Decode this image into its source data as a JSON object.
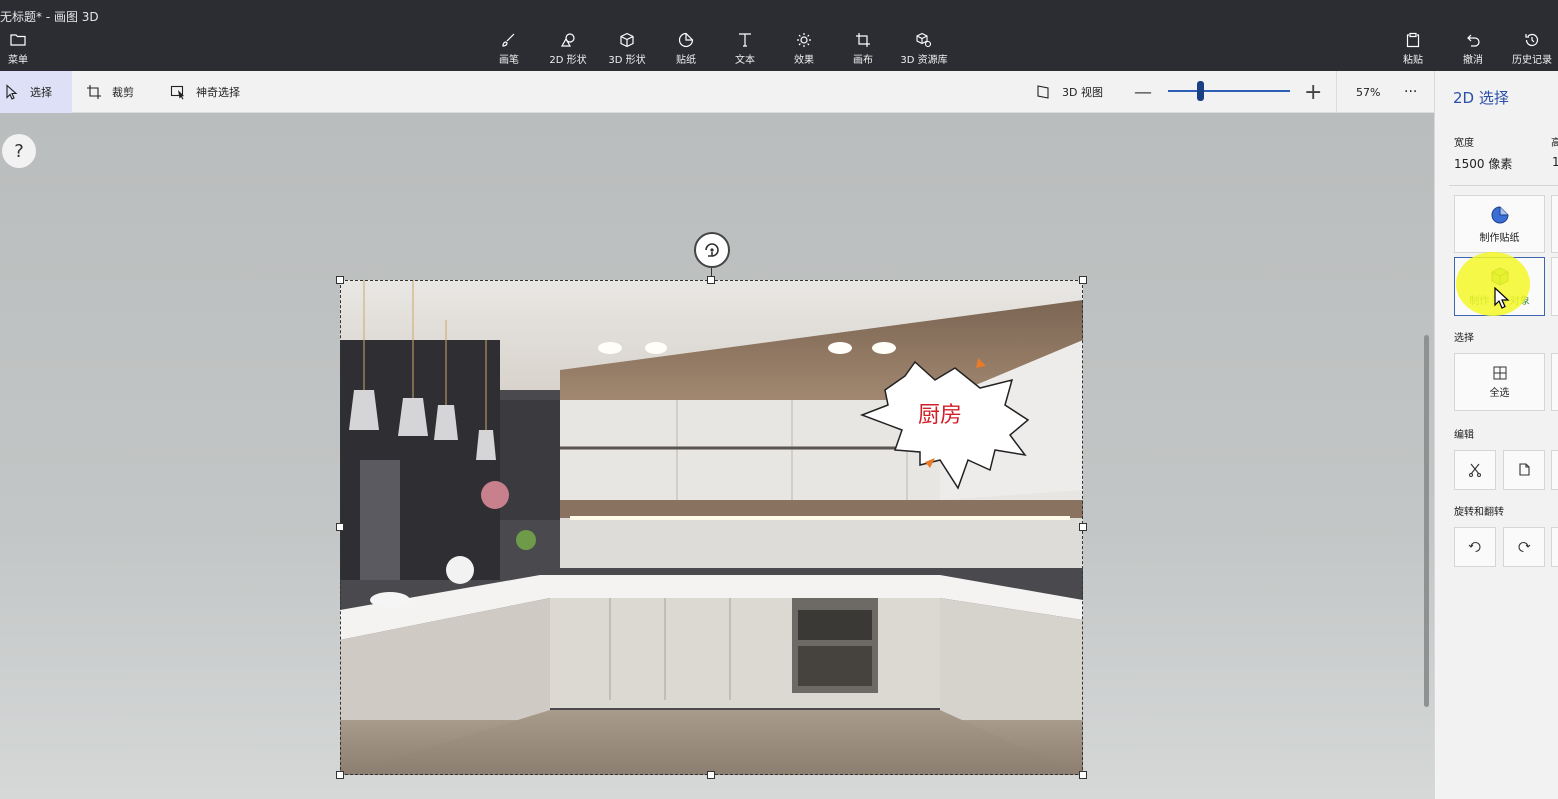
{
  "window": {
    "title": "无标题* - 画图 3D"
  },
  "toolbar": {
    "menu": "菜单",
    "brushes": "画笔",
    "shapes2d": "2D 形状",
    "shapes3d": "3D 形状",
    "stickers": "贴纸",
    "text": "文本",
    "effects": "效果",
    "canvas": "画布",
    "library3d": "3D 资源库",
    "paste": "粘贴",
    "undo": "撤消",
    "history": "历史记录"
  },
  "subtoolbar": {
    "select": "选择",
    "crop": "裁剪",
    "magic_select": "神奇选择",
    "view3d": "3D 视图",
    "zoom_value": "57%",
    "zoom_level": 0.57,
    "more": "···"
  },
  "canvas": {
    "help": "?",
    "sticker_text": "厨房"
  },
  "panel": {
    "title": "2D 选择",
    "width_label": "宽度",
    "width_value": "1500 像素",
    "height_label_partial": "高",
    "height_value_partial": "1",
    "make_sticker": "制作贴纸",
    "make_3d": "制作 3D 对象",
    "select_section": "选择",
    "select_all": "全选",
    "edit_section": "编辑",
    "rotate_section": "旋转和翻转"
  },
  "colors": {
    "accent": "#2a4fa8",
    "titlebar": "#2b2d33",
    "sticker_text": "#d0202a"
  }
}
